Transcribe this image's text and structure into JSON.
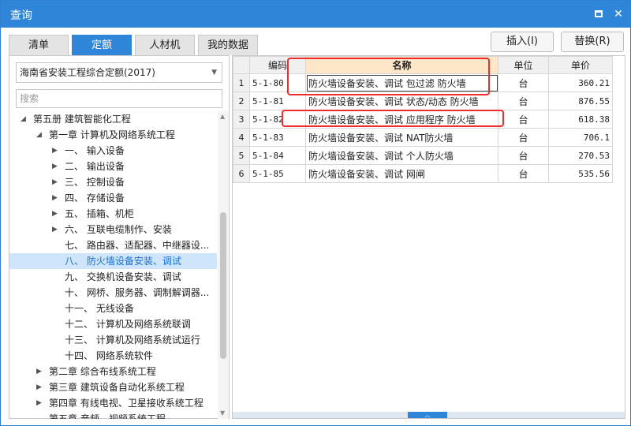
{
  "window": {
    "title": "查询"
  },
  "tabs": [
    {
      "label": "清单",
      "active": false
    },
    {
      "label": "定额",
      "active": true
    },
    {
      "label": "人材机",
      "active": false
    },
    {
      "label": "我的数据",
      "active": false
    }
  ],
  "actions": {
    "insert_label": "插入(I)",
    "replace_label": "替换(R)"
  },
  "left": {
    "library_select": "海南省安装工程综合定额(2017)",
    "search_placeholder": "搜索",
    "tree": [
      {
        "label": "第五册 建筑智能化工程",
        "expanded": true,
        "selected": false
      },
      {
        "label": "第一章 计算机及网络系统工程",
        "expanded": true,
        "selected": false
      },
      {
        "label": "一、 输入设备",
        "expanded": false,
        "selected": false
      },
      {
        "label": "二、 输出设备",
        "expanded": false,
        "selected": false
      },
      {
        "label": "三、 控制设备",
        "expanded": false,
        "selected": false
      },
      {
        "label": "四、 存储设备",
        "expanded": false,
        "selected": false
      },
      {
        "label": "五、 插箱、机柜",
        "expanded": false,
        "selected": false
      },
      {
        "label": "六、 互联电缆制作、安装",
        "expanded": false,
        "selected": false
      },
      {
        "label": "七、 路由器、适配器、中继器设...",
        "expanded": null,
        "selected": false
      },
      {
        "label": "八、 防火墙设备安装、调试",
        "expanded": null,
        "selected": true
      },
      {
        "label": "九、 交换机设备安装、调试",
        "expanded": null,
        "selected": false
      },
      {
        "label": "十、 网桥、服务器、调制解调器...",
        "expanded": null,
        "selected": false
      },
      {
        "label": "十一、 无线设备",
        "expanded": null,
        "selected": false
      },
      {
        "label": "十二、 计算机及网络系统联调",
        "expanded": null,
        "selected": false
      },
      {
        "label": "十三、 计算机及网络系统试运行",
        "expanded": null,
        "selected": false
      },
      {
        "label": "十四、 网络系统软件",
        "expanded": null,
        "selected": false
      },
      {
        "label": "第二章 综合布线系统工程",
        "expanded": false,
        "selected": false
      },
      {
        "label": "第三章 建筑设备自动化系统工程",
        "expanded": false,
        "selected": false
      },
      {
        "label": "第四章 有线电视、卫星接收系统工程",
        "expanded": false,
        "selected": false
      },
      {
        "label": "第五章 音频、视频系统工程",
        "expanded": false,
        "selected": false
      }
    ]
  },
  "grid": {
    "columns": {
      "code": "编码",
      "name": "名称",
      "unit": "单位",
      "price": "单价"
    },
    "rows": [
      {
        "n": "1",
        "code": "5-1-80",
        "name": "防火墙设备安装、调试 包过滤 防火墙",
        "unit": "台",
        "price": "360.21"
      },
      {
        "n": "2",
        "code": "5-1-81",
        "name": "防火墙设备安装、调试 状态/动态 防火墙",
        "unit": "台",
        "price": "876.55"
      },
      {
        "n": "3",
        "code": "5-1-82",
        "name": "防火墙设备安装、调试 应用程序 防火墙",
        "unit": "台",
        "price": "618.38"
      },
      {
        "n": "4",
        "code": "5-1-83",
        "name": "防火墙设备安装、调试 NAT防火墙",
        "unit": "台",
        "price": "706.1"
      },
      {
        "n": "5",
        "code": "5-1-84",
        "name": "防火墙设备安装、调试 个人防火墙",
        "unit": "台",
        "price": "270.53"
      },
      {
        "n": "6",
        "code": "5-1-85",
        "name": "防火墙设备安装、调试 网闸",
        "unit": "台",
        "price": "535.56"
      }
    ]
  },
  "colors": {
    "accent": "#2f86d9",
    "highlight": "#ef2b2b",
    "selected_row": "#cfe5fb"
  }
}
